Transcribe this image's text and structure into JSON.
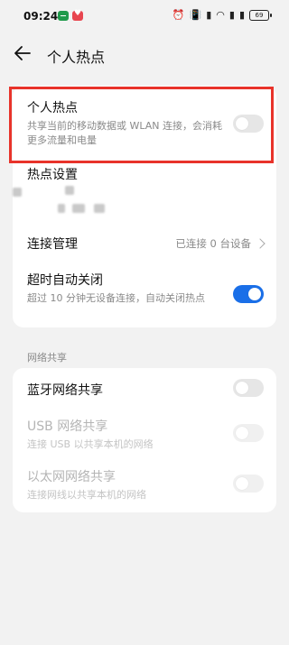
{
  "status_bar": {
    "time": "09:24",
    "icons": [
      "alarm-icon",
      "vibrate-icon",
      "signal-icon",
      "wifi-icon",
      "signal-icon",
      "signal-icon"
    ],
    "battery": "69"
  },
  "header": {
    "title": "个人热点",
    "back_icon": "back-arrow-icon"
  },
  "hotspot": {
    "title": "个人热点",
    "subtitle": "共享当前的移动数据或 WLAN 连接，会消耗更多流量和电量",
    "enabled": false
  },
  "hotspot_settings": {
    "title": "热点设置"
  },
  "connection_management": {
    "title": "连接管理",
    "value": "已连接 0 台设备"
  },
  "auto_off": {
    "title": "超时自动关闭",
    "subtitle": "超过 10 分钟无设备连接，自动关闭热点",
    "enabled": true
  },
  "network_sharing": {
    "section_title": "网络共享",
    "bluetooth": {
      "title": "蓝牙网络共享",
      "enabled": false
    },
    "usb": {
      "title": "USB 网络共享",
      "subtitle": "连接 USB 以共享本机的网络",
      "enabled": false,
      "disabled": true
    },
    "ethernet": {
      "title": "以太网网络共享",
      "subtitle": "连接网线以共享本机的网络",
      "enabled": false,
      "disabled": true
    }
  },
  "colors": {
    "accent": "#1a6fe8",
    "highlight": "#e8332a",
    "background": "#f2f2f2"
  }
}
